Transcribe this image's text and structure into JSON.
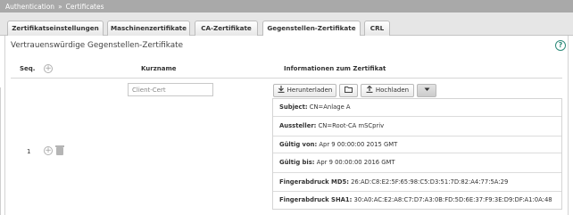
{
  "breadcrumb": {
    "root": "Authentication",
    "separator": "»",
    "current": "Certificates"
  },
  "tabs": [
    {
      "label": "Zertifikatseinstellungen"
    },
    {
      "label": "Maschinenzertifikate"
    },
    {
      "label": "CA-Zertifikate"
    },
    {
      "label": "Gegenstellen-Zertifikate",
      "active": true
    },
    {
      "label": "CRL"
    }
  ],
  "section": {
    "title": "Vertrauenswürdige Gegenstellen-Zertifikate",
    "help_icon": "help-icon"
  },
  "table": {
    "headers": {
      "seq": "Seq.",
      "kurzname": "Kurzname",
      "info": "Informationen zum Zertifikat"
    },
    "rows": [
      {
        "seq": "1",
        "kurzname": "Client-Cert",
        "buttons": {
          "download": "Herunterladen",
          "upload": "Hochladen"
        },
        "cert": [
          {
            "label": "Subject:",
            "value": "CN=Anlage A"
          },
          {
            "label": "Aussteller:",
            "value": "CN=Root-CA mSCpriv"
          },
          {
            "label": "Gültig von:",
            "value": "Apr 9 00:00:00 2015 GMT"
          },
          {
            "label": "Gültig bis:",
            "value": "Apr 9 00:00:00 2016 GMT"
          },
          {
            "label": "Fingerabdruck MD5:",
            "value": "26:AD:C8:E2:5F:65:98:C5:D3:51:7D:82:A4:77:5A:29"
          },
          {
            "label": "Fingerabdruck SHA1:",
            "value": "30:A0:AC:E2:A8:C7:D7:A3:0B:FD:5D:6E:37:F9:3E:D9:DF:A1:0A:48"
          }
        ]
      }
    ]
  },
  "colors": {
    "titlebar": "#a9a9a9",
    "help": "#2e8b7a"
  }
}
